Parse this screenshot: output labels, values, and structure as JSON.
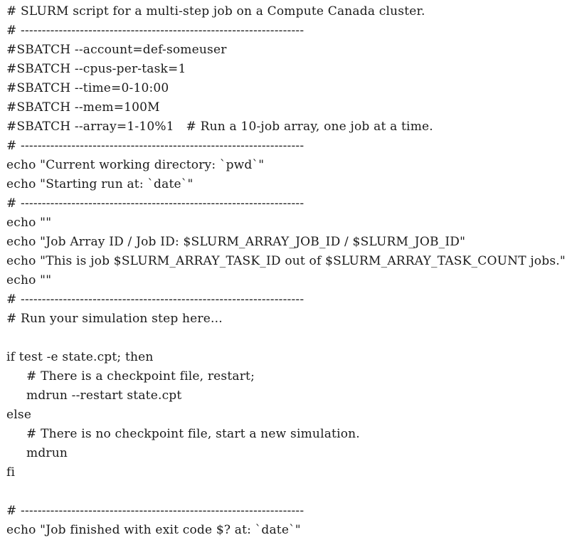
{
  "script": {
    "lines": [
      "# SLURM script for a multi-step job on a Compute Canada cluster.",
      "# -------------------------------------------------------------------",
      "#SBATCH --account=def-someuser",
      "#SBATCH --cpus-per-task=1",
      "#SBATCH --time=0-10:00",
      "#SBATCH --mem=100M",
      "#SBATCH --array=1-10%1   # Run a 10-job array, one job at a time.",
      "# -------------------------------------------------------------------",
      "echo \"Current working directory: `pwd`\"",
      "echo \"Starting run at: `date`\"",
      "# -------------------------------------------------------------------",
      "echo \"\"",
      "echo \"Job Array ID / Job ID: $SLURM_ARRAY_JOB_ID / $SLURM_JOB_ID\"",
      "echo \"This is job $SLURM_ARRAY_TASK_ID out of $SLURM_ARRAY_TASK_COUNT jobs.\"",
      "echo \"\"",
      "# -------------------------------------------------------------------",
      "# Run your simulation step here...",
      "",
      "if test -e state.cpt; then",
      "     # There is a checkpoint file, restart;",
      "     mdrun --restart state.cpt",
      "else",
      "     # There is no checkpoint file, start a new simulation.",
      "     mdrun",
      "fi",
      "",
      "# -------------------------------------------------------------------",
      "echo \"Job finished with exit code $? at: `date`\""
    ]
  }
}
